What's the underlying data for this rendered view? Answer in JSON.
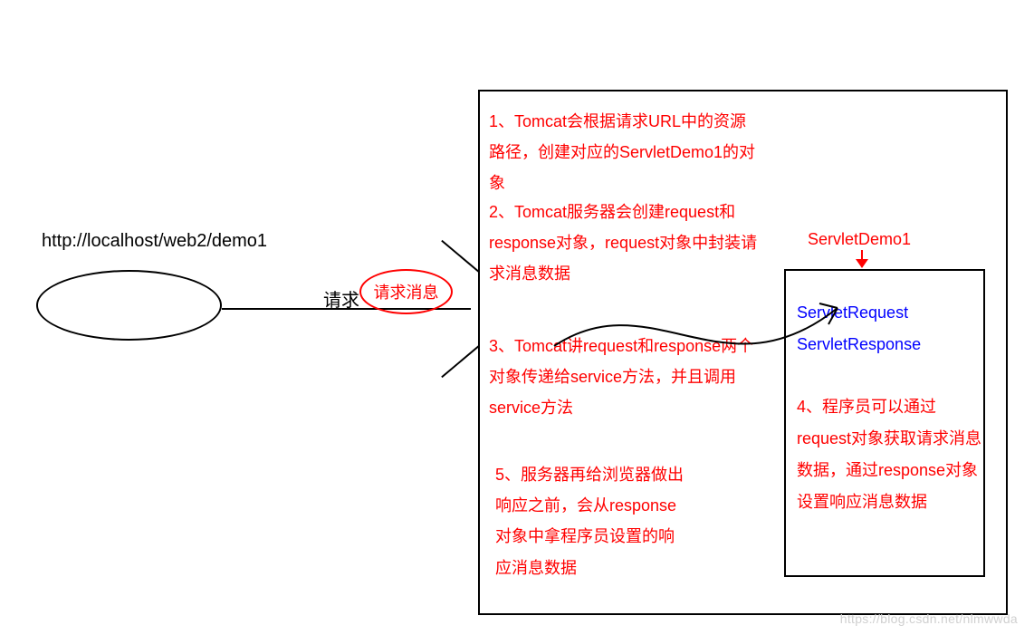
{
  "url_label": "http://localhost/web2/demo1",
  "request_label": "请求",
  "request_message_label": "请求消息",
  "step1": "1、Tomcat会根据请求URL中的资源路径，创建对应的ServletDemo1的对象",
  "step2": "2、Tomcat服务器会创建request和response对象，request对象中封装请求消息数据",
  "step3": "3、Tomcat讲request和response两个对象传递给service方法，并且调用service方法",
  "step4": "4、程序员可以通过request对象获取请求消息数据，通过response对象设置响应消息数据",
  "step5": "5、服务器再给浏览器做出响应之前，会从response对象中拿程序员设置的响应消息数据",
  "servlet_label": "ServletDemo1",
  "servlet_request": "ServletRequest",
  "servlet_response": "ServletResponse",
  "watermark": "https://blog.csdn.net/nlmwwda",
  "colors": {
    "red": "#ff0000",
    "blue": "#0000ff",
    "black": "#000000"
  }
}
